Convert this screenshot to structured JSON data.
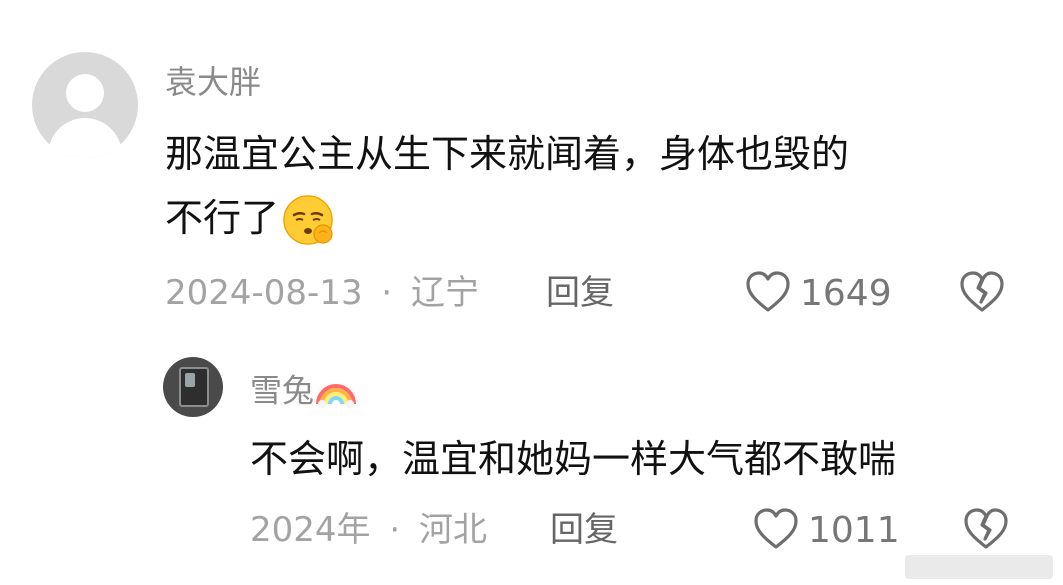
{
  "comment": {
    "username": "袁大胖",
    "text_line1": "那温宜公主从生下来就闻着，身体也毁的",
    "text_line2": "不行了",
    "emoji_icon": "sad-face-emoji",
    "date": "2024-08-13",
    "separator": "·",
    "location": "辽宁",
    "reply_label": "回复",
    "like_count": "1649"
  },
  "reply": {
    "username": "雪兔",
    "badge_icon": "rainbow-emoji",
    "text": "不会啊，温宜和她妈一样大气都不敢喘",
    "date": "2024年",
    "separator": "·",
    "location": "河北",
    "reply_label": "回复",
    "like_count": "1011"
  },
  "colors": {
    "username": "#8a8a8a",
    "content": "#111111",
    "meta": "#a3a3a3",
    "icon": "#6e6e6e"
  }
}
